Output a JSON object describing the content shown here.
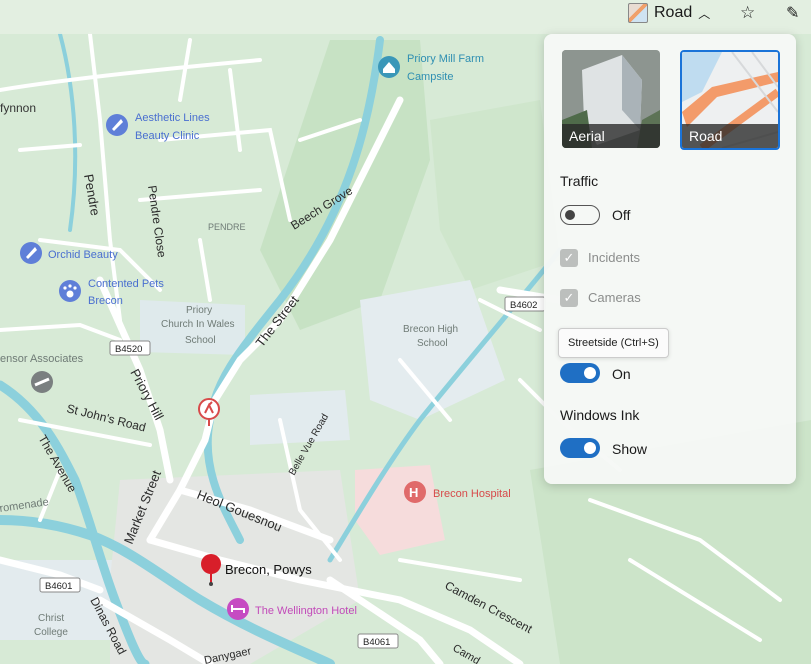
{
  "topbar": {
    "map_style_label": "Road",
    "chevron": "^",
    "favorites_icon": "star-list-icon",
    "ink_icon": "pen-icon"
  },
  "panel": {
    "styles": [
      {
        "label": "Aerial",
        "selected": false
      },
      {
        "label": "Road",
        "selected": true
      }
    ],
    "traffic": {
      "title": "Traffic",
      "toggle_state": "Off",
      "incidents": "Incidents",
      "cameras": "Cameras"
    },
    "streetside": {
      "tooltip": "Streetside (Ctrl+S)",
      "toggle_state": "On"
    },
    "ink": {
      "title": "Windows Ink",
      "toggle_state": "Show"
    }
  },
  "map": {
    "pois": {
      "priory_mill": [
        "Priory Mill Farm",
        "Campsite"
      ],
      "aesthetic": [
        "Aesthetic Lines",
        "Beauty Clinic"
      ],
      "orchid": "Orchid Beauty",
      "contented": [
        "Contented Pets",
        "Brecon"
      ],
      "hospital": "Brecon Hospital",
      "wellington": "The Wellington Hotel",
      "pin": "Brecon, Powys"
    },
    "areas": {
      "brecon_high": [
        "Brecon High",
        "School"
      ],
      "priory_church": [
        "Priory",
        "Church In Wales",
        "School"
      ],
      "christ": [
        "Christ",
        "College"
      ],
      "pendre": "PENDRE",
      "ensor": "ensor Associates",
      "fynnon": "fynnon"
    },
    "streets": {
      "pendre": "Pendre",
      "pendre_close": "Pendre Close",
      "beech_grove": "Beech Grove",
      "the_street": "The Street",
      "priory_hill": "Priory Hill",
      "st_johns": "St John's Road",
      "the_avenue": "The Avenue",
      "market_street": "Market Street",
      "heol_gouesnou": "Heol Gouesnou",
      "belle_vue": "Belle Vue Road",
      "camden": "Camden Crescent",
      "dinas": "Dinas Road",
      "romenade": "romenade",
      "danygaer": "Danygaer",
      "camden_cut": "Camd"
    },
    "shields": {
      "b4602": "B4602",
      "b4520": "B4520",
      "b4601": "B4601",
      "b4061": "B4061"
    }
  }
}
